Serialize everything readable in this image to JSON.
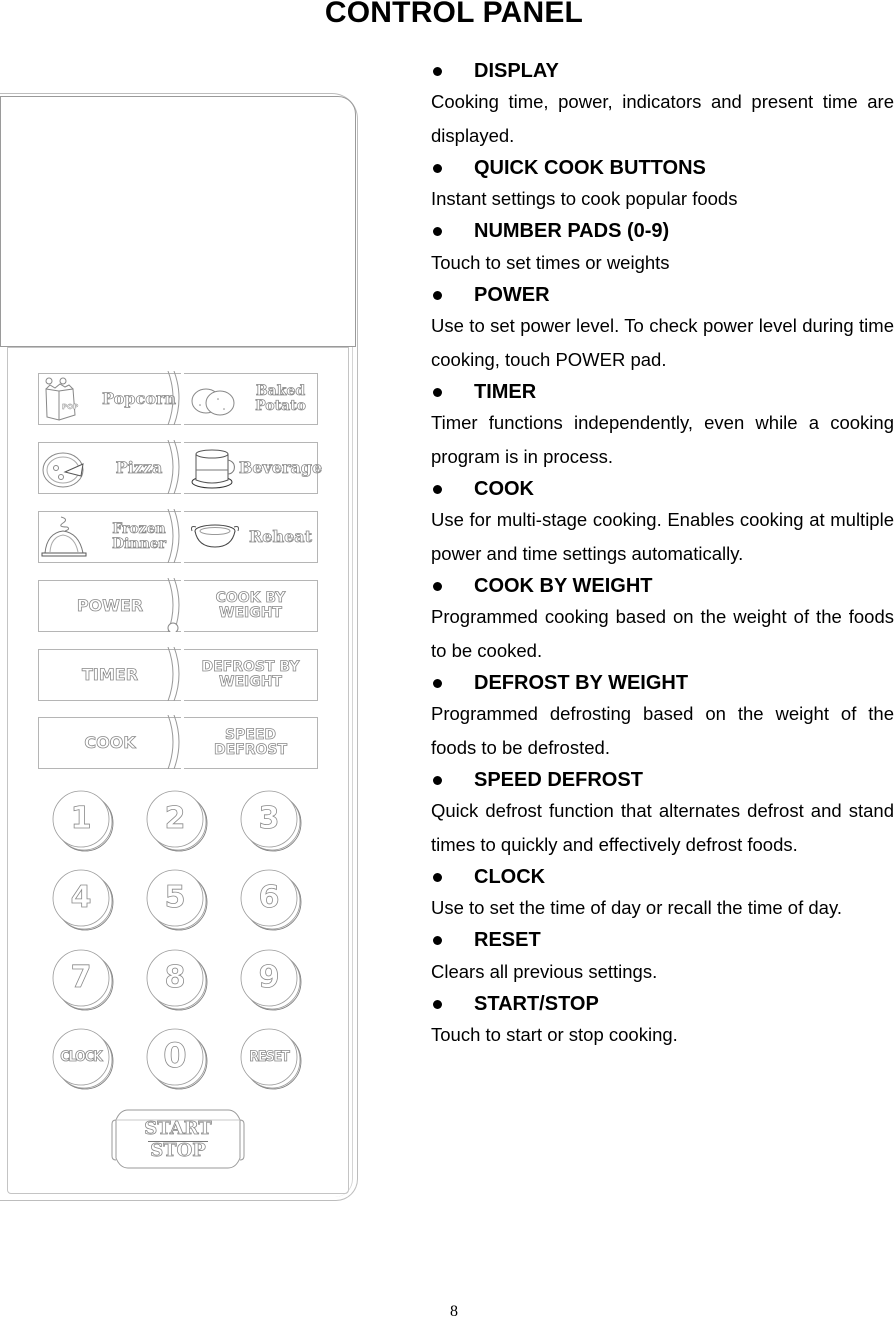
{
  "page": {
    "title": "CONTROL PANEL",
    "page_number": "8"
  },
  "panel": {
    "display_label": "Display window",
    "pad_rows": [
      {
        "left": {
          "label": "Popcorn",
          "icon": "popcorn-bag-icon"
        },
        "right": {
          "label": "Baked\nPotato",
          "icon": "baked-potato-icon"
        }
      },
      {
        "left": {
          "label": "Pizza",
          "icon": "pizza-icon"
        },
        "right": {
          "label": "Beverage",
          "icon": "beverage-cup-icon"
        }
      },
      {
        "left": {
          "label": "Frozen\nDinner",
          "icon": "frozen-dinner-cloche-icon"
        },
        "right": {
          "label": "Reheat",
          "icon": "reheat-pan-icon"
        }
      },
      {
        "left": {
          "label": "POWER"
        },
        "right": {
          "label": "COOK BY\nWEIGHT"
        }
      },
      {
        "left": {
          "label": "TIMER"
        },
        "right": {
          "label": "DEFROST BY\nWEIGHT"
        }
      },
      {
        "left": {
          "label": "COOK"
        },
        "right": {
          "label": "SPEED\nDEFROST"
        }
      }
    ],
    "number_pads": [
      "1",
      "2",
      "3",
      "4",
      "5",
      "6",
      "7",
      "8",
      "9",
      "CLOCK",
      "0",
      "RESET"
    ],
    "start_stop": {
      "top": "START",
      "bottom": "STOP"
    }
  },
  "descriptions": [
    {
      "heading": "DISPLAY",
      "body": "Cooking time, power, indicators and present time are displayed."
    },
    {
      "heading": "QUICK COOK BUTTONS",
      "body": "Instant settings to cook popular foods"
    },
    {
      "heading": "NUMBER PADS (0-9)",
      "body": "Touch to set times or weights"
    },
    {
      "heading": "POWER",
      "body": "Use to set power level. To check power level during time cooking, touch POWER pad."
    },
    {
      "heading": "TIMER",
      "body": "Timer functions independently, even while a cooking program is in process."
    },
    {
      "heading": "COOK",
      "body": "Use for multi-stage cooking.   Enables cooking at multiple power and time settings automatically."
    },
    {
      "heading": "COOK BY WEIGHT",
      "body": "Programmed cooking based on the weight of the foods to be cooked."
    },
    {
      "heading": "DEFROST BY WEIGHT",
      "body": "Programmed defrosting based on the weight of the foods to be defrosted."
    },
    {
      "heading": "SPEED DEFROST",
      "body": "Quick defrost function that alternates defrost and stand times to quickly and effectively defrost foods."
    },
    {
      "heading": "CLOCK",
      "body": "Use to set the time of day or recall the time of day."
    },
    {
      "heading": "RESET",
      "body": "Clears all previous settings."
    },
    {
      "heading": "START/STOP",
      "body": "Touch to start or stop cooking."
    }
  ]
}
